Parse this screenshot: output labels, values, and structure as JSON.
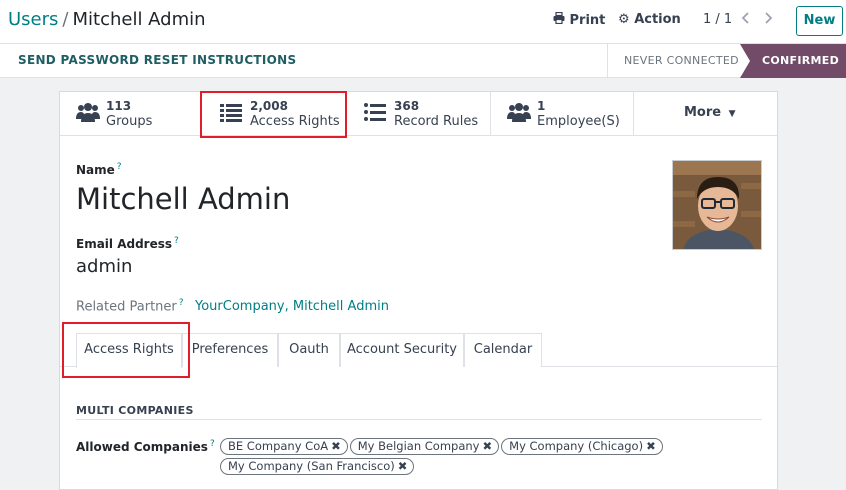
{
  "breadcrumb": {
    "parent": "Users",
    "separator": "/",
    "current": "Mitchell Admin"
  },
  "toolbar": {
    "print_label": "Print",
    "action_label": "Action",
    "pager": "1 / 1",
    "new_label": "New"
  },
  "statusbar": {
    "reset_label": "SEND PASSWORD RESET INSTRUCTIONS",
    "stages": [
      "NEVER CONNECTED",
      "CONFIRMED"
    ],
    "active_stage": "CONFIRMED"
  },
  "smart_buttons": [
    {
      "count": "113",
      "label": "Groups",
      "icon": "users-icon"
    },
    {
      "count": "2,008",
      "label": "Access Rights",
      "icon": "list-icon"
    },
    {
      "count": "368",
      "label": "Record Rules",
      "icon": "list-icon"
    },
    {
      "count": "1",
      "label": "Employee(S)",
      "icon": "users-icon"
    }
  ],
  "more_label": "More",
  "form": {
    "name_label": "Name",
    "name_value": "Mitchell Admin",
    "email_label": "Email Address",
    "email_value": "admin",
    "partner_label": "Related Partner",
    "partner_value": "YourCompany, Mitchell Admin",
    "help_marker": "?"
  },
  "tabs": [
    "Access Rights",
    "Preferences",
    "Oauth",
    "Account Security",
    "Calendar"
  ],
  "active_tab": "Access Rights",
  "multi_companies": {
    "title": "MULTI COMPANIES",
    "allowed_label": "Allowed Companies",
    "companies": [
      "BE Company CoA",
      "My Belgian Company",
      "My Company (Chicago)",
      "My Company (San Francisco)"
    ]
  },
  "colors": {
    "accent": "#017e84",
    "stage_active": "#714b67",
    "highlight": "#e11d2a"
  }
}
